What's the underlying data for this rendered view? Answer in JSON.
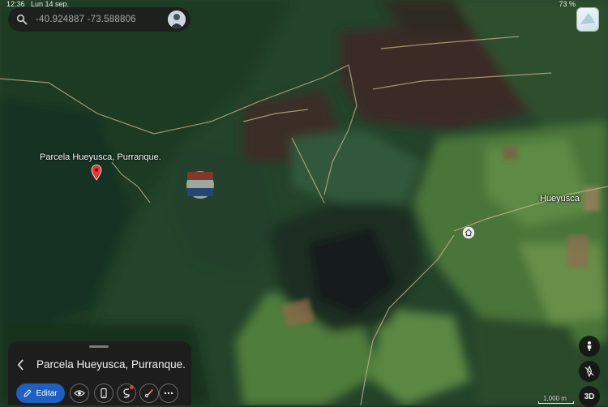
{
  "status_bar": {
    "time": "12:36",
    "date": "Lun 14 sep.",
    "battery": "73 %"
  },
  "search": {
    "coordinates": "-40.924887   -73.588806",
    "icon": "search-icon"
  },
  "map": {
    "place_label": "Parcela Hueyusca, Purranque.",
    "town_label": "Hueyusca",
    "scale_label": "1,000 m"
  },
  "place_panel": {
    "title": "Parcela Hueyusca, Purranque.",
    "edit_label": "Editar",
    "accent_color": "#1f5fbf"
  },
  "controls": {
    "view_mode_label": "3D"
  },
  "colors": {
    "pin": "#e53935",
    "forest_dark": "#1d3a24",
    "farmland": "#4f7a3a"
  }
}
